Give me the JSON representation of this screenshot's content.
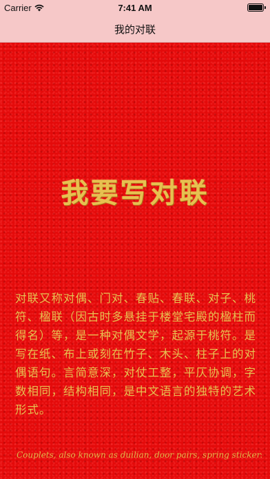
{
  "status_bar": {
    "carrier": "Carrier",
    "time": "7:41 AM",
    "wifi_icon": "wifi-icon",
    "battery_icon": "battery-icon"
  },
  "nav_bar": {
    "title": "我的对联"
  },
  "content": {
    "headline": "我要写对联",
    "description": "对联又称对偶、门对、春贴、春联、对子、桃符、楹联（因古时多悬挂于楼堂宅殿的楹柱而得名）等，是一种对偶文学，起源于桃符。是写在纸、布上或刻在竹子、木头、柱子上的对偶语句。言简意深，对仗工整，平仄协调，字数相同，结构相同，是中文语言的独特的艺术形式。",
    "english_preview": "Couplets, also known as duilian, door pairs, spring stickers"
  },
  "colors": {
    "background_red": "#e40a0a",
    "gold_text": "#e7c050",
    "bar_pink": "#f6c8c8"
  }
}
